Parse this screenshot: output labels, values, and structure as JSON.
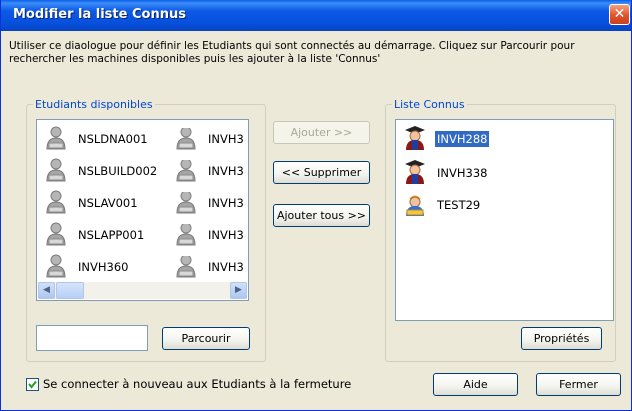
{
  "window": {
    "title": "Modifier la liste Connus",
    "close_glyph": "✕"
  },
  "description": "Utiliser ce diaologue pour définir les Etudiants qui sont connectés au démarrage. Cliquez sur Parcourir pour rechercher les machines disponibles puis les ajouter à la liste 'Connus'",
  "available": {
    "legend": "Etudiants disponibles",
    "col1": [
      "NSLDNA001",
      "NSLBUILD002",
      "NSLAV001",
      "NSLAPP001",
      "INVH360"
    ],
    "col2": [
      "INVH3",
      "INVH3",
      "INVH3",
      "INVH3",
      "INVH3"
    ],
    "icon": "student-computer-icon",
    "search_value": "",
    "browse_label": "Parcourir"
  },
  "actions": {
    "add_label": "Ajouter >>",
    "remove_label": "<< Supprimer",
    "add_all_label": "Ajouter tous >>"
  },
  "known": {
    "legend": "Liste Connus",
    "items": [
      {
        "label": "INVH288",
        "icon": "graduate-icon",
        "selected": true
      },
      {
        "label": "INVH338",
        "icon": "graduate-icon",
        "selected": false
      },
      {
        "label": "TEST29",
        "icon": "student-icon",
        "selected": false
      }
    ],
    "properties_label": "Propriétés"
  },
  "footer": {
    "reconnect_checkbox_label": "Se connecter à nouveau aux Etudiants à la fermeture",
    "reconnect_checked": true,
    "help_label": "Aide",
    "close_label": "Fermer"
  },
  "colors": {
    "title_bar": "#0650dd",
    "legend_text": "#0046d5",
    "selection": "#316ac5"
  }
}
